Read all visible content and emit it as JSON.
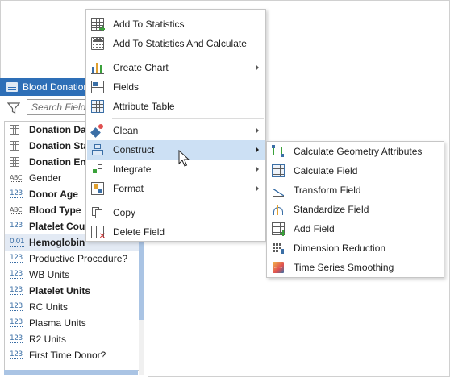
{
  "pane": {
    "title": "Blood Donations",
    "search_placeholder": "Search Fields",
    "fields": [
      {
        "name": "Donation Date",
        "type": "date",
        "bold": true
      },
      {
        "name": "Donation Start",
        "type": "date",
        "bold": true
      },
      {
        "name": "Donation End",
        "type": "date",
        "bold": true
      },
      {
        "name": "Gender",
        "type": "text",
        "bold": false
      },
      {
        "name": "Donor Age",
        "type": "number",
        "bold": true
      },
      {
        "name": "Blood Type",
        "type": "text",
        "bold": true
      },
      {
        "name": "Platelet Count",
        "type": "number",
        "bold": true
      },
      {
        "name": "Hemoglobin",
        "type": "double",
        "bold": true,
        "selected": true
      },
      {
        "name": "Productive Procedure?",
        "type": "number",
        "bold": false
      },
      {
        "name": "WB Units",
        "type": "number",
        "bold": false
      },
      {
        "name": "Platelet Units",
        "type": "number",
        "bold": true
      },
      {
        "name": "RC Units",
        "type": "number",
        "bold": false
      },
      {
        "name": "Plasma Units",
        "type": "number",
        "bold": false
      },
      {
        "name": "R2 Units",
        "type": "number",
        "bold": false
      },
      {
        "name": "First Time Donor?",
        "type": "number",
        "bold": false
      }
    ],
    "type_glyphs": {
      "number": "123",
      "double": "0.01",
      "text": "ABC"
    }
  },
  "context_menu": {
    "items": [
      {
        "label": "Add To Statistics",
        "icon": "add-statistics-icon"
      },
      {
        "label": "Add To Statistics And Calculate",
        "icon": "calculator-icon"
      },
      {
        "label": "Create Chart",
        "icon": "chart-icon",
        "submenu": true
      },
      {
        "label": "Fields",
        "icon": "fields-icon"
      },
      {
        "label": "Attribute Table",
        "icon": "attribute-table-icon"
      },
      {
        "label": "Clean",
        "icon": "clean-icon",
        "submenu": true
      },
      {
        "label": "Construct",
        "icon": "construct-icon",
        "submenu": true,
        "highlighted": true
      },
      {
        "label": "Integrate",
        "icon": "integrate-icon",
        "submenu": true
      },
      {
        "label": "Format",
        "icon": "format-icon",
        "submenu": true
      },
      {
        "label": "Copy",
        "icon": "copy-icon"
      },
      {
        "label": "Delete Field",
        "icon": "delete-field-icon"
      }
    ]
  },
  "construct_submenu": {
    "items": [
      {
        "label": "Calculate Geometry Attributes",
        "icon": "calculate-geometry-icon"
      },
      {
        "label": "Calculate Field",
        "icon": "calculate-field-icon"
      },
      {
        "label": "Transform Field",
        "icon": "transform-field-icon"
      },
      {
        "label": "Standardize Field",
        "icon": "standardize-field-icon"
      },
      {
        "label": "Add Field",
        "icon": "add-field-icon"
      },
      {
        "label": "Dimension Reduction",
        "icon": "dimension-reduction-icon"
      },
      {
        "label": "Time Series Smoothing",
        "icon": "time-series-smoothing-icon"
      }
    ]
  },
  "colors": {
    "title_bar": "#2e6fb7",
    "hover": "#cce0f4",
    "selected_row": "#e3eaf4",
    "scrollbar": "#aac4e4"
  }
}
